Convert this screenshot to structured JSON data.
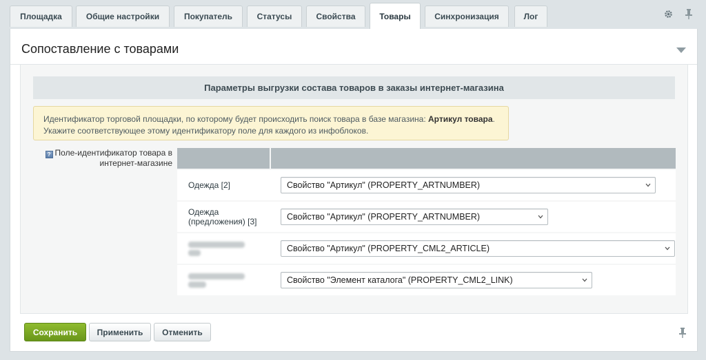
{
  "tabs": [
    {
      "label": "Площадка",
      "active": false
    },
    {
      "label": "Общие настройки",
      "active": false
    },
    {
      "label": "Покупатель",
      "active": false
    },
    {
      "label": "Статусы",
      "active": false
    },
    {
      "label": "Свойства",
      "active": false
    },
    {
      "label": "Товары",
      "active": true
    },
    {
      "label": "Синхронизация",
      "active": false
    },
    {
      "label": "Лог",
      "active": false
    }
  ],
  "toolbar_icons": [
    "gear-icon",
    "pin-icon"
  ],
  "panel": {
    "title": "Сопоставление с товарами",
    "collapse_icon": "triangle-down-icon"
  },
  "section": {
    "header": "Параметры выгрузки состава товаров в заказы интернет-магазина"
  },
  "notice": {
    "line1_prefix": "Идентификатор торговой площадки, по которому будет происходить поиск товара в базе магазина: ",
    "line1_bold": "Артикул товара",
    "line1_suffix": ".",
    "line2": "Укажите соответствующее этому идентификатору поле для каждого из инфоблоков."
  },
  "field": {
    "label": "Поле-идентификатор товара в интернет-магазине",
    "help_icon": "help-icon"
  },
  "mapping_rows": [
    {
      "name_line1": "Одежда [2]",
      "name_line2": "",
      "blurred": false,
      "selected": "Свойство \"Артикул\" (PROPERTY_ARTNUMBER)"
    },
    {
      "name_line1": "Одежда",
      "name_line2": "(предложения) [3]",
      "blurred": false,
      "selected": "Свойство \"Артикул\" (PROPERTY_ARTNUMBER)"
    },
    {
      "name_line1": "",
      "name_line2": "",
      "blurred": true,
      "selected": "Свойство \"Артикул\" (PROPERTY_CML2_ARTICLE)"
    },
    {
      "name_line1": "",
      "name_line2": "",
      "blurred": true,
      "selected": "Свойство \"Элемент каталога\" (PROPERTY_CML2_LINK)"
    }
  ],
  "buttons": {
    "save": "Сохранить",
    "apply": "Применить",
    "cancel": "Отменить"
  },
  "colors": {
    "save_button": "#7aa824",
    "grid_header": "#b1babe",
    "notice_bg": "#fcf5d4"
  }
}
